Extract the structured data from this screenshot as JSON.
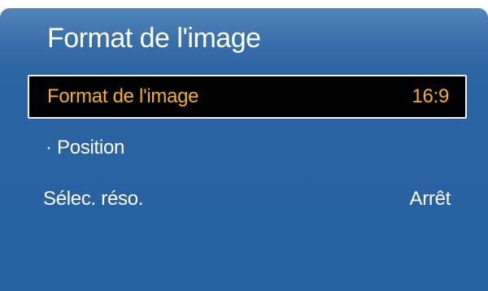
{
  "screen": {
    "title": "Format de l'image"
  },
  "menu": {
    "items": [
      {
        "label": "Format de l'image",
        "value": "16:9",
        "selected": true
      },
      {
        "label": "· Position",
        "value": "",
        "selected": false
      },
      {
        "label": "Sélec. réso.",
        "value": "Arrêt",
        "selected": false
      }
    ]
  },
  "colors": {
    "panel_background": "#2a63a2",
    "selected_background": "#000000",
    "selected_text": "#f2b01e",
    "text": "#ffffff",
    "selection_border": "#f2f2f2"
  }
}
